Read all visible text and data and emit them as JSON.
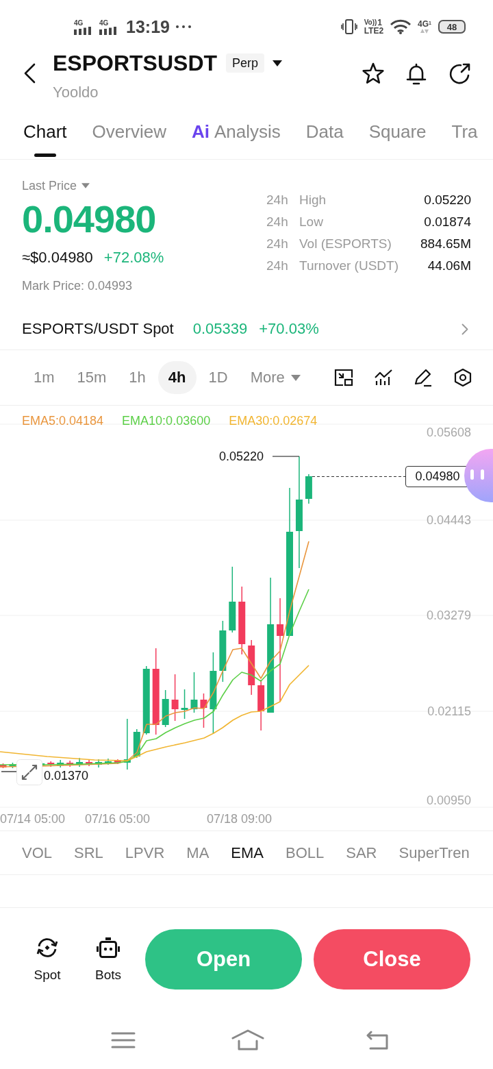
{
  "status_bar": {
    "networks": [
      {
        "label": "4G"
      },
      {
        "label": "4G"
      }
    ],
    "time": "13:19",
    "volte": "Vo))",
    "volte_sim": "1",
    "lte": "LTE2",
    "data": "4G",
    "data_sim": "1",
    "battery": "48"
  },
  "header": {
    "title": "ESPORTSUSDT",
    "badge": "Perp",
    "subtitle": "Yooldo"
  },
  "tabs": [
    {
      "label": "Chart",
      "selected": true
    },
    {
      "label": "Overview",
      "selected": false
    },
    {
      "label": "Analysis",
      "badge": "Ai",
      "selected": false
    },
    {
      "label": "Data",
      "selected": false
    },
    {
      "label": "Square",
      "selected": false
    },
    {
      "label": "Tra",
      "selected": false
    }
  ],
  "price": {
    "label": "Last Price",
    "last": "0.04980",
    "usd": "≈$0.04980",
    "change": "+72.08%",
    "mark": "Mark Price: 0.04993"
  },
  "stats": [
    {
      "period": "24h",
      "label": "High",
      "value": "0.05220"
    },
    {
      "period": "24h",
      "label": "Low",
      "value": "0.01874"
    },
    {
      "period": "24h",
      "label": "Vol (ESPORTS)",
      "value": "884.65M"
    },
    {
      "period": "24h",
      "label": "Turnover (USDT)",
      "value": "44.06M"
    }
  ],
  "spot": {
    "pair": "ESPORTS/USDT Spot",
    "price": "0.05339",
    "change": "+70.03%"
  },
  "intervals": [
    {
      "label": "1m",
      "selected": false
    },
    {
      "label": "15m",
      "selected": false
    },
    {
      "label": "1h",
      "selected": false
    },
    {
      "label": "4h",
      "selected": true
    },
    {
      "label": "1D",
      "selected": false
    }
  ],
  "more": "More",
  "chart": {
    "ema": [
      {
        "label": "EMA5:0.04184",
        "color": "#e9963e"
      },
      {
        "label": "EMA10:0.03600",
        "color": "#5ccf48"
      },
      {
        "label": "EMA30:0.02674",
        "color": "#f1b531"
      }
    ],
    "y_labels": [
      "0.05608",
      "0.04443",
      "0.03279",
      "0.02115",
      "0.00950"
    ],
    "x_labels": [
      "07/14 05:00",
      "07/16 05:00",
      "07/18 09:00"
    ],
    "high": "0.05220",
    "low": "0.01370",
    "last": "0.04980"
  },
  "indicators": [
    {
      "label": "VOL",
      "selected": false
    },
    {
      "label": "SRL",
      "selected": false
    },
    {
      "label": "LPVR",
      "selected": false
    },
    {
      "label": "MA",
      "selected": false
    },
    {
      "label": "EMA",
      "selected": true
    },
    {
      "label": "BOLL",
      "selected": false
    },
    {
      "label": "SAR",
      "selected": false
    },
    {
      "label": "SuperTren",
      "selected": false
    }
  ],
  "shortcuts": [
    {
      "label": "Spot",
      "kind": "spot"
    },
    {
      "label": "Bots",
      "kind": "bots"
    }
  ],
  "actions": [
    {
      "label": "Open",
      "kind": "buy"
    },
    {
      "label": "Close",
      "kind": "sell"
    }
  ]
}
